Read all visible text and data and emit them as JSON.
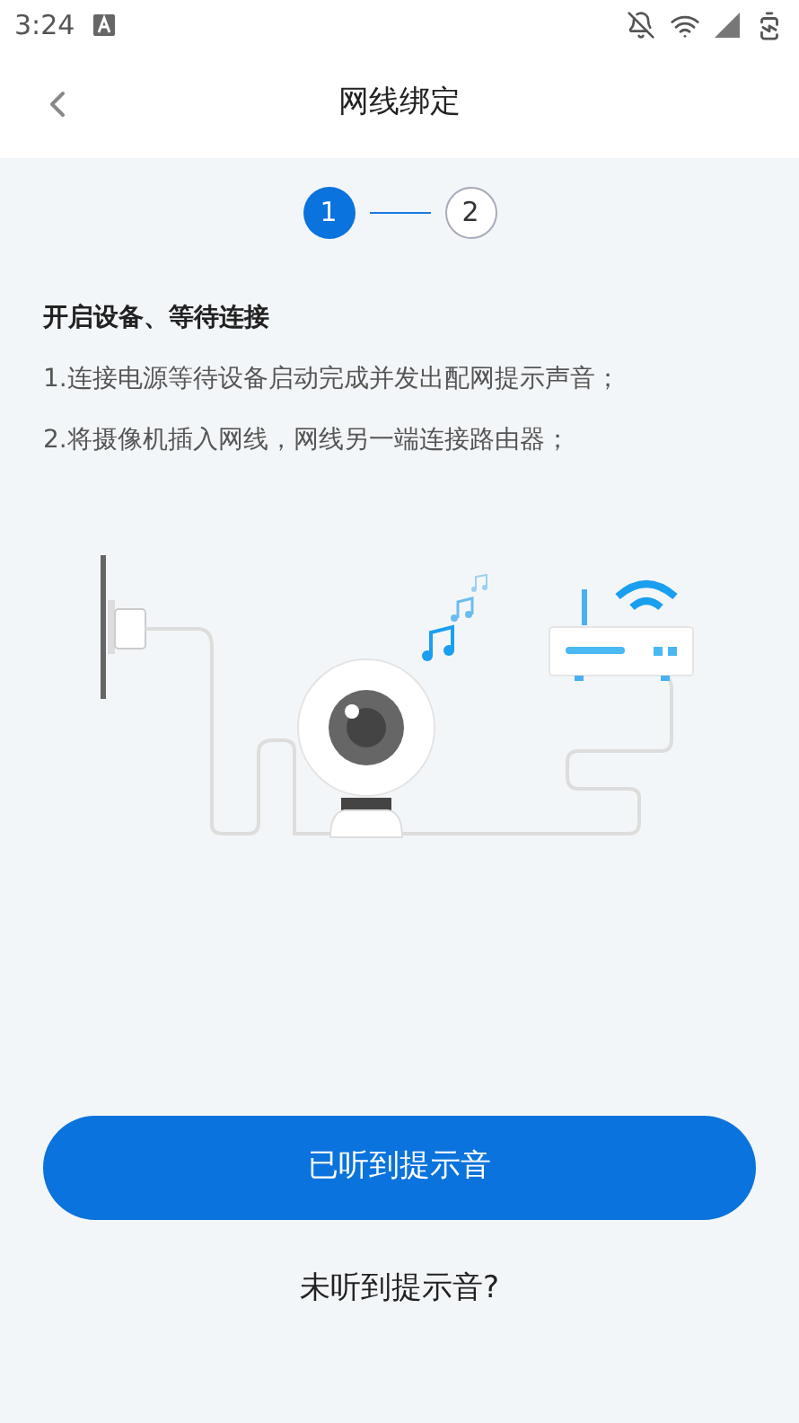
{
  "status_bar": {
    "time": "3:24"
  },
  "header": {
    "title": "网线绑定"
  },
  "steps": [
    {
      "label": "1",
      "selected": true
    },
    {
      "label": "2",
      "selected": false
    }
  ],
  "instructions": {
    "heading": "开启设备、等待连接",
    "lines": [
      "1.连接电源等待设备启动完成并发出配网提示声音；",
      "2.将摄像机插入网线，网线另一端连接路由器；"
    ]
  },
  "primary_button": "已听到提示音",
  "secondary_link": "未听到提示音?"
}
